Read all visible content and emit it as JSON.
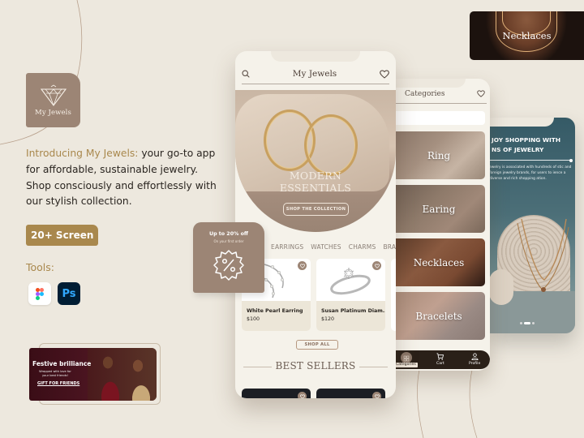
{
  "brand": {
    "logo_text": "My Jewels",
    "accent_color": "#a9884d",
    "tile_color": "#9c8575",
    "background_color": "#ede8de"
  },
  "intro": {
    "highlight": "Introducing My Jewels:",
    "body": " your go-to app for affordable, sustainable jewelry. Shop consciously and effortlessly with our stylish collection."
  },
  "screens_badge": "20+ Screen",
  "tools": {
    "label": "Tools:",
    "items": [
      {
        "name": "Figma",
        "icon": "figma-icon"
      },
      {
        "name": "Photoshop",
        "icon": "photoshop-icon",
        "glyph": "Ps"
      }
    ]
  },
  "festive_banner": {
    "title": "Festive brilliance",
    "subtitle": "Wrapped with love for your best friends!",
    "cta": "GIFT FOR FRIENDS"
  },
  "discount_badge": {
    "title": "Up to 20% off",
    "subtitle": "On your first order",
    "icon": "percent-badge-icon"
  },
  "home_screen": {
    "header_title": "My Jewels",
    "hero": {
      "title_line1": "MODERN",
      "title_line2": "ESSENTIALS",
      "button": "SHOP THE COLLECTION"
    },
    "category_tabs": [
      "EARRINGS",
      "WATCHES",
      "CHARMS",
      "BRAC"
    ],
    "products": [
      {
        "name": "White Pearl Earring",
        "price": "$100"
      },
      {
        "name": "Susan Platinum Diam...",
        "price": "$120"
      }
    ],
    "shop_all": "SHOP ALL",
    "best_sellers": "BEST SELLERS"
  },
  "categories_screen": {
    "title": "Categories",
    "search_placeholder": "",
    "tiles": [
      "Ring",
      "Earing",
      "Necklaces",
      "Bracelets"
    ],
    "nav": [
      {
        "label": "Categories",
        "icon": "grid-icon",
        "active": true
      },
      {
        "label": "Cart",
        "icon": "cart-icon",
        "active": false
      },
      {
        "label": "Profile",
        "icon": "profile-icon",
        "active": false
      }
    ]
  },
  "onboarding_screen": {
    "title_line1": "JOY SHOPPING WITH",
    "title_line2": "NS OF JEWELRY",
    "description": "ewelry is associated with hundreds of stic and foreign jewelry brands, for users to ience a diverse and rich shopping ation.",
    "pagination": {
      "pages": 3,
      "active": 2
    }
  },
  "necklaces_banner": {
    "label": "Necklaces"
  }
}
